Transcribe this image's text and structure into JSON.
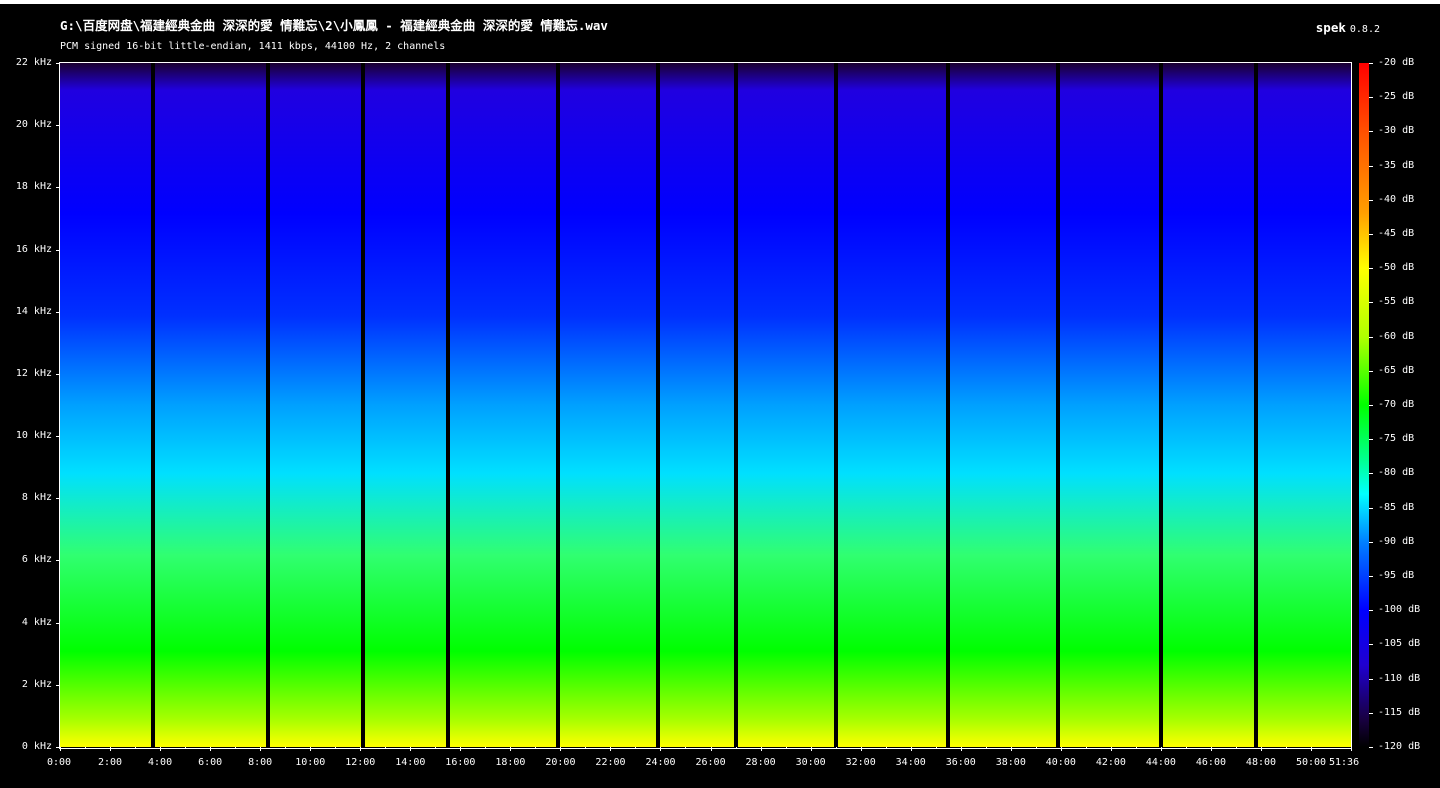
{
  "header": {
    "file_title": "G:\\百度网盘\\福建經典金曲 深深的愛 情難忘\\2\\小鳳鳳 - 福建經典金曲 深深的愛 情難忘.wav",
    "file_info": "PCM signed 16-bit little-endian, 1411 kbps, 44100 Hz, 2 channels",
    "app_name": "spek",
    "app_version": "0.8.2"
  },
  "frequency_axis": {
    "unit": "kHz",
    "labels": [
      "22 kHz",
      "20 kHz",
      "18 kHz",
      "16 kHz",
      "14 kHz",
      "12 kHz",
      "10 kHz",
      "8 kHz",
      "6 kHz",
      "4 kHz",
      "2 kHz",
      "0 kHz"
    ]
  },
  "time_axis": {
    "labels": [
      "0:00",
      "2:00",
      "4:00",
      "6:00",
      "8:00",
      "10:00",
      "12:00",
      "14:00",
      "16:00",
      "18:00",
      "20:00",
      "22:00",
      "24:00",
      "26:00",
      "28:00",
      "30:00",
      "32:00",
      "34:00",
      "36:00",
      "38:00",
      "40:00",
      "42:00",
      "44:00",
      "46:00",
      "48:00",
      "50:00",
      "51:36"
    ],
    "end_label": "51:36"
  },
  "colorbar": {
    "labels": [
      "-20 dB",
      "-25 dB",
      "-30 dB",
      "-35 dB",
      "-40 dB",
      "-45 dB",
      "-50 dB",
      "-55 dB",
      "-60 dB",
      "-65 dB",
      "-70 dB",
      "-75 dB",
      "-80 dB",
      "-85 dB",
      "-90 dB",
      "-95 dB",
      "-100 dB",
      "-105 dB",
      "-110 dB",
      "-115 dB",
      "-120 dB"
    ]
  },
  "track_boundaries_minutes": [
    3.7,
    8.3,
    12.1,
    15.5,
    19.9,
    23.9,
    27.0,
    31.0,
    35.5,
    39.9,
    44.0,
    47.8
  ],
  "colors": {
    "background": "#000000",
    "text": "#ffffff",
    "loud": "#ffff00",
    "mid": "#00ff00",
    "quiet": "#0000ff"
  }
}
